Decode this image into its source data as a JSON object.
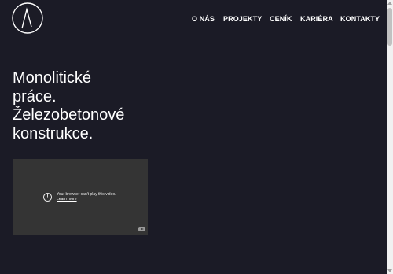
{
  "header": {
    "logo": {
      "icon": "circle-slash-logo",
      "color": "#ffffff"
    },
    "nav": [
      {
        "label": "O NÁS"
      },
      {
        "label": "PROJEKTY"
      },
      {
        "label": "CENÍK"
      },
      {
        "label": "KARIÉRA"
      },
      {
        "label": "KONTAKTY"
      }
    ]
  },
  "hero": {
    "lines": [
      "Monolitické",
      "práce.",
      "Železobetonové",
      "konstrukce."
    ]
  },
  "video": {
    "error_message": "Your browser can't play this video.",
    "learn_more": "Learn more",
    "info_icon": "info-icon",
    "youtube_icon": "youtube-icon"
  },
  "colors": {
    "background": "#1b1b26",
    "text": "#ffffff",
    "video_bg": "#343434"
  }
}
